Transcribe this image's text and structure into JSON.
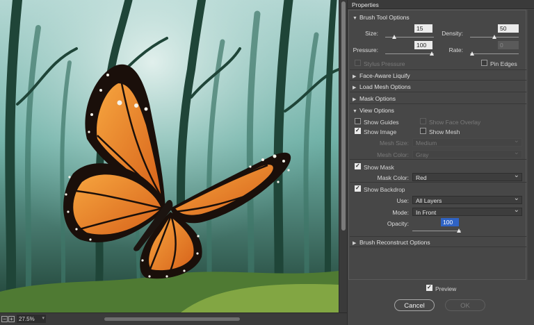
{
  "panel": {
    "title": "Properties"
  },
  "brush": {
    "header": "Brush Tool Options",
    "size_label": "Size:",
    "size_value": "15",
    "size_level": 0.15,
    "density_label": "Density:",
    "density_value": "50",
    "density_level": 0.5,
    "pressure_label": "Pressure:",
    "pressure_value": "100",
    "pressure_level": 1.0,
    "rate_label": "Rate:",
    "rate_value": "0",
    "rate_level": 0.0,
    "stylus_label": "Stylus Pressure",
    "pin_edges_label": "Pin Edges"
  },
  "sections": {
    "face_aware": "Face-Aware Liquify",
    "load_mesh": "Load Mesh Options",
    "mask_options": "Mask Options",
    "view_options": "View Options",
    "brush_reconstruct": "Brush Reconstruct Options"
  },
  "view": {
    "show_guides": "Show Guides",
    "show_face_overlay": "Show Face Overlay",
    "show_image": "Show Image",
    "show_mesh": "Show Mesh",
    "mesh_size_label": "Mesh Size:",
    "mesh_size_value": "Medium",
    "mesh_color_label": "Mesh Color:",
    "mesh_color_value": "Gray",
    "show_mask": "Show Mask",
    "mask_color_label": "Mask Color:",
    "mask_color_value": "Red",
    "show_backdrop": "Show Backdrop",
    "use_label": "Use:",
    "use_value": "All Layers",
    "mode_label": "Mode:",
    "mode_value": "In Front",
    "opacity_label": "Opacity:",
    "opacity_value": "100",
    "opacity_level": 1.0
  },
  "footer": {
    "preview_label": "Preview",
    "cancel_label": "Cancel",
    "ok_label": "OK"
  },
  "status": {
    "zoom": "27.5%"
  },
  "colors": {
    "accent": "#2f63c4",
    "panel_bg": "#474747",
    "butterfly_orange": "#e9791f"
  }
}
